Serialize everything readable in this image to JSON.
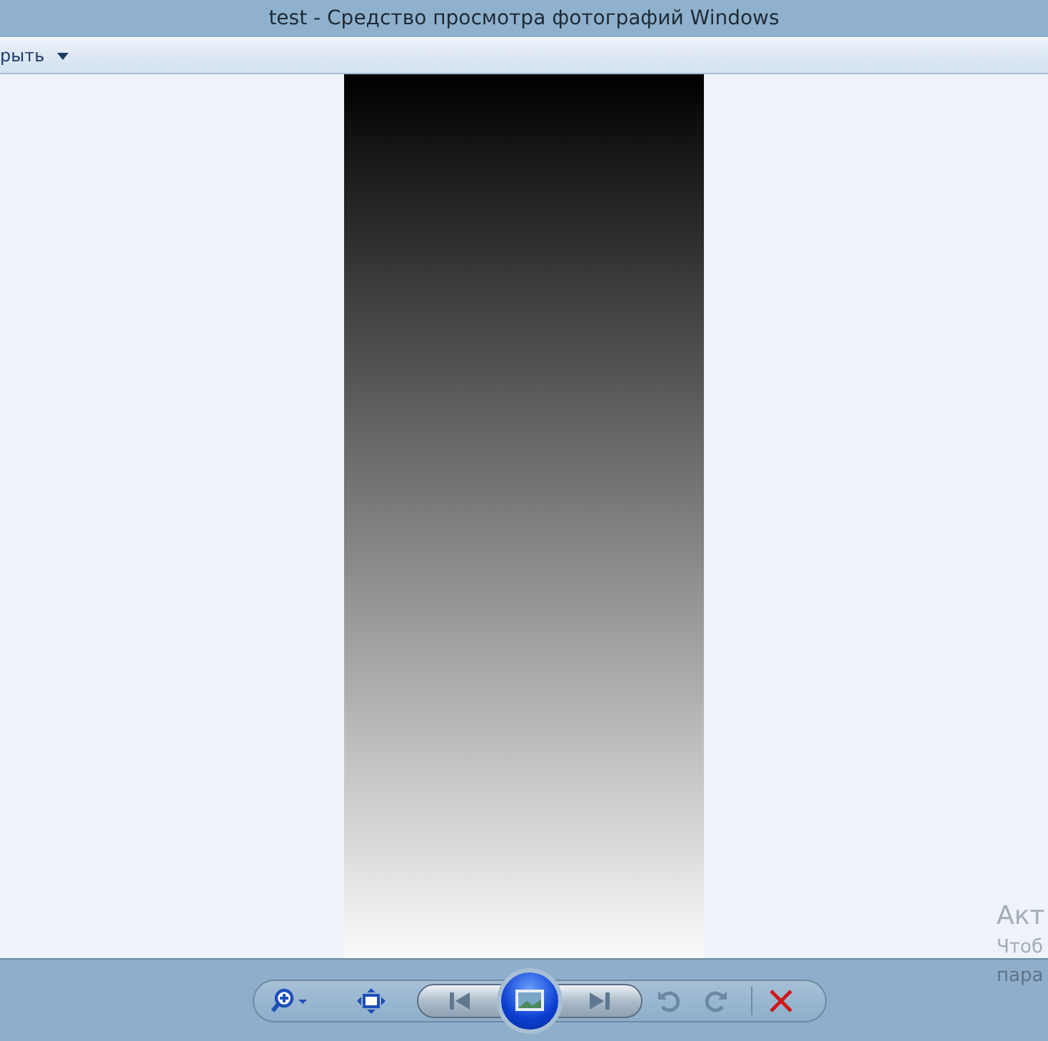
{
  "window": {
    "title": "test - Средство просмотра фотографий Windows"
  },
  "menu_bar": {
    "items": [
      {
        "label": "рыть"
      }
    ]
  },
  "activation_notice": [
    "Акт",
    "Чтоб",
    "пара"
  ]
}
